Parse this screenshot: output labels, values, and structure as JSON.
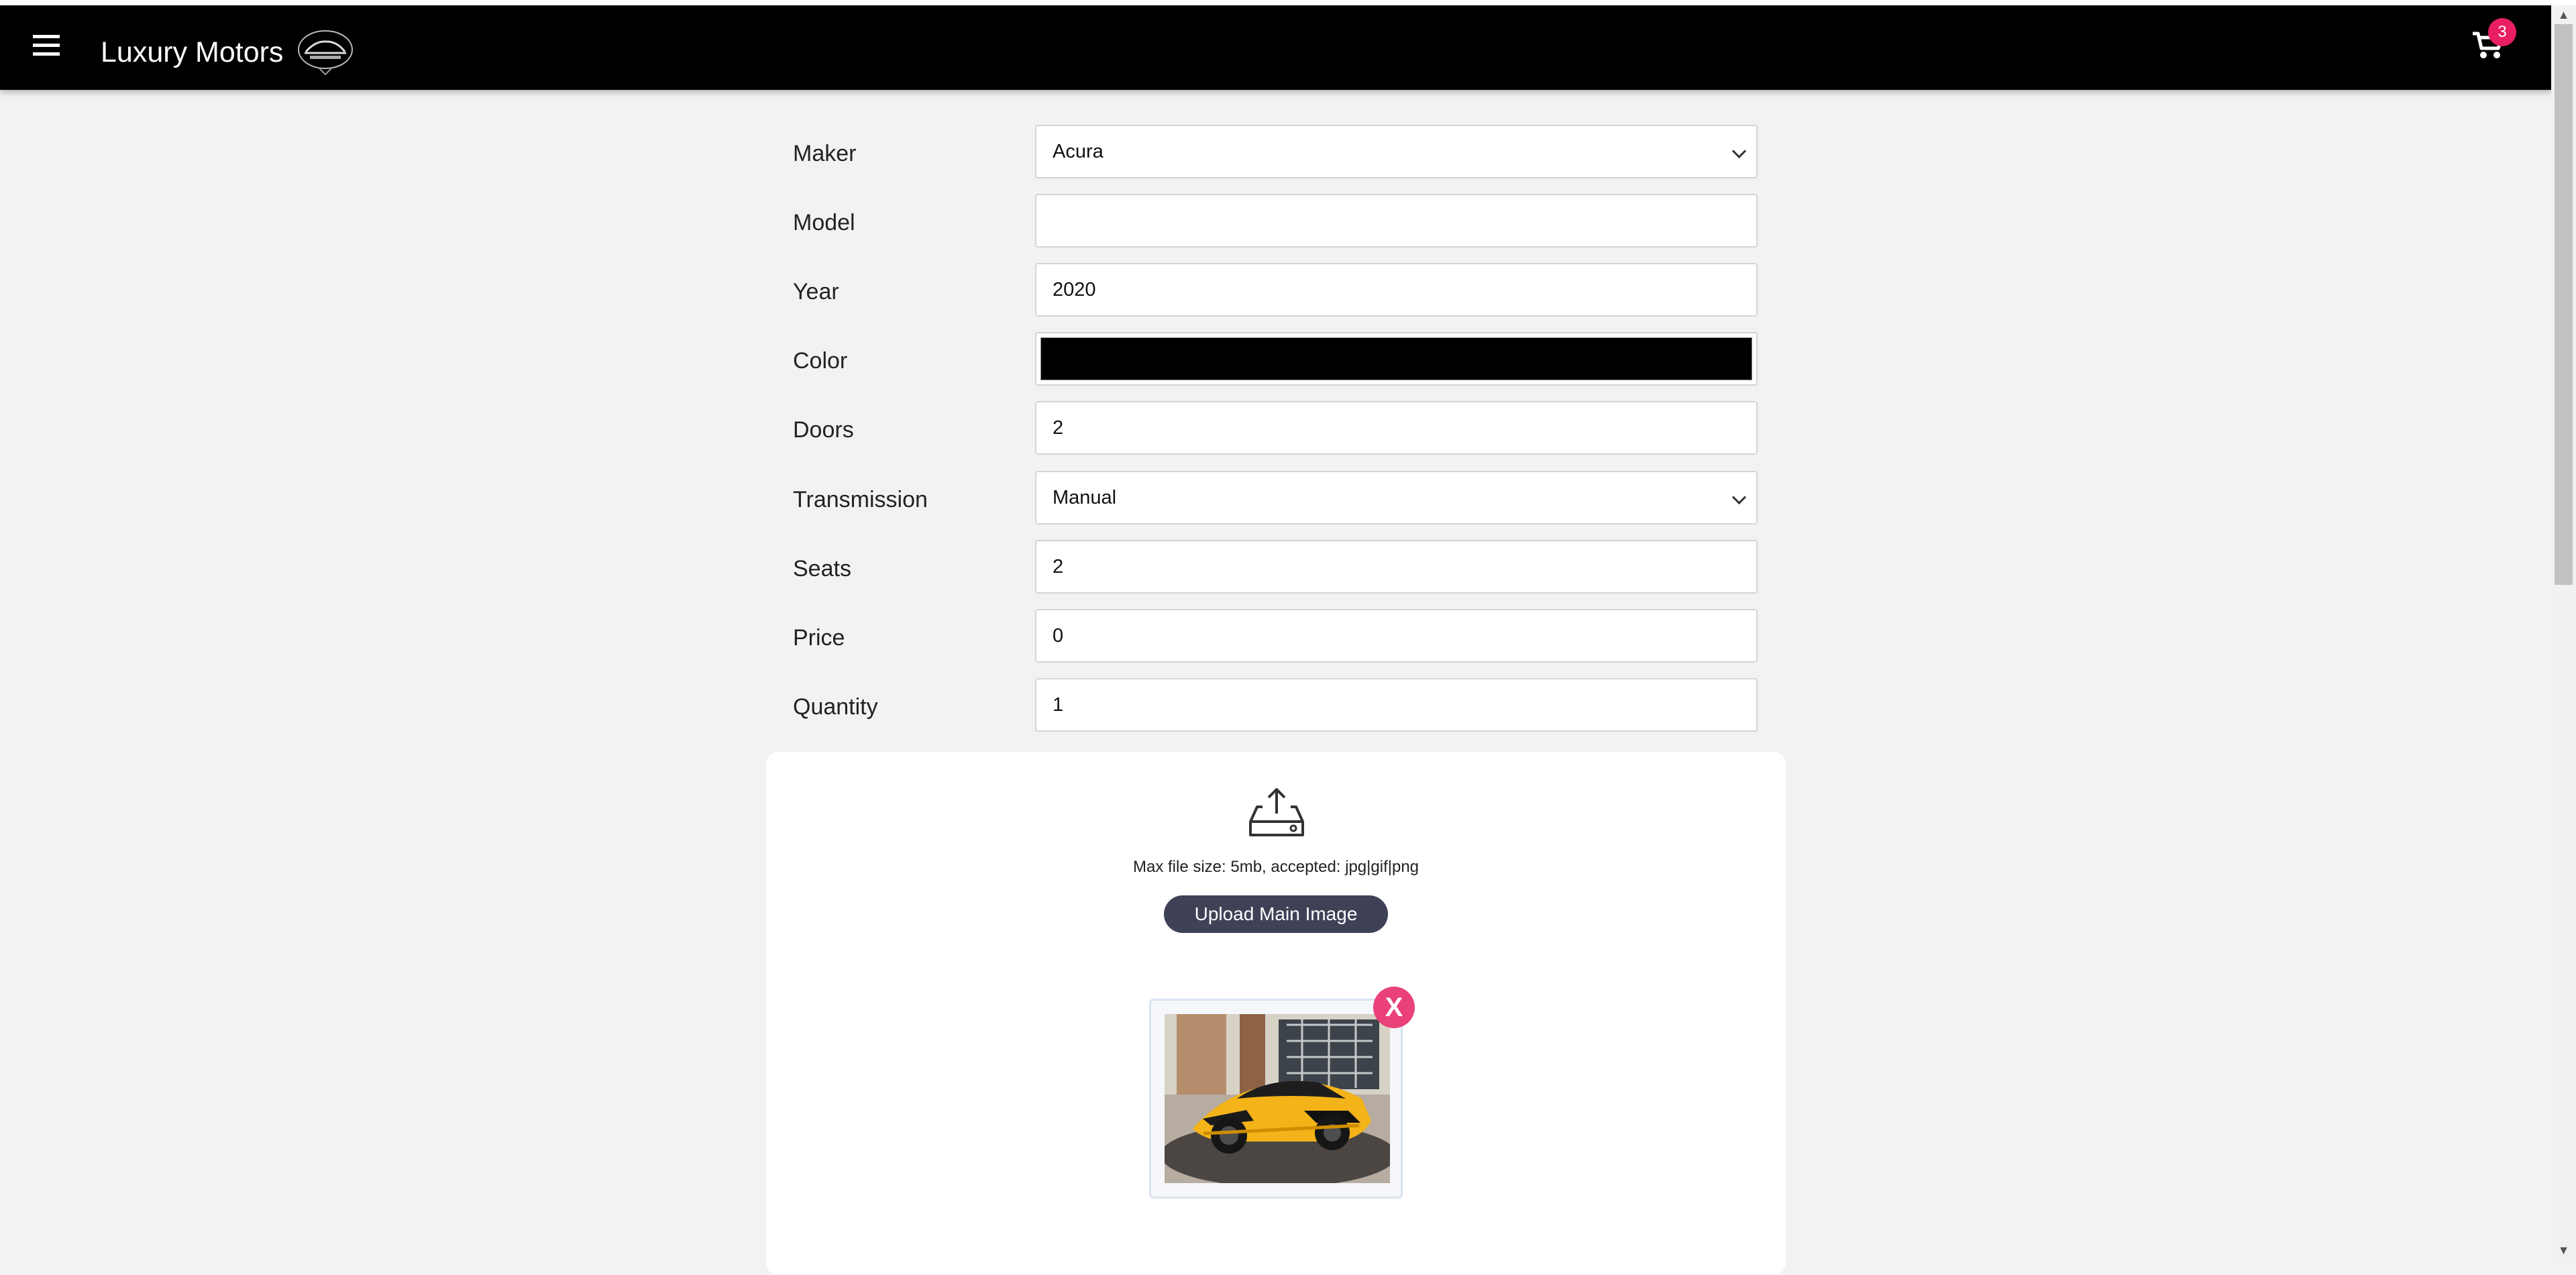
{
  "app": {
    "title": "Luxury Motors",
    "cart_count": "3",
    "colors": {
      "appbar": "#000000",
      "badge": "#e91e63",
      "upload_button": "#3f4257",
      "remove_button": "#e94178"
    }
  },
  "form": {
    "maker": {
      "label": "Maker",
      "value": "Acura"
    },
    "model": {
      "label": "Model",
      "value": ""
    },
    "year": {
      "label": "Year",
      "value": "2020"
    },
    "color": {
      "label": "Color",
      "value": "#000000"
    },
    "doors": {
      "label": "Doors",
      "value": "2"
    },
    "transmission": {
      "label": "Transmission",
      "value": "Manual"
    },
    "seats": {
      "label": "Seats",
      "value": "2"
    },
    "price": {
      "label": "Price",
      "value": "0"
    },
    "quantity": {
      "label": "Quantity",
      "value": "1"
    }
  },
  "upload": {
    "hint": "Max file size: 5mb, accepted: jpg|gif|png",
    "button_label": "Upload Main Image",
    "remove_label": "X"
  }
}
